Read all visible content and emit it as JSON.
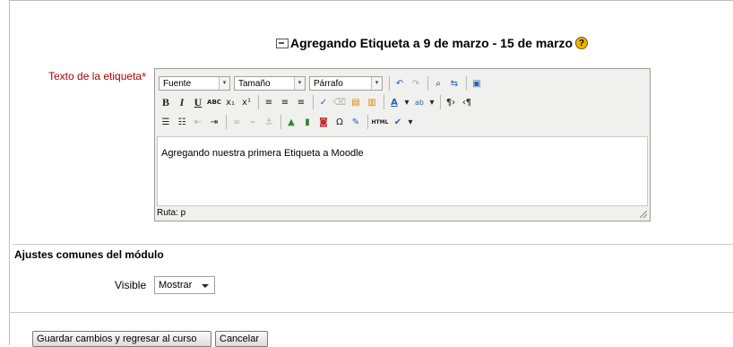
{
  "page": {
    "title": "Agregando Etiqueta a 9 de marzo - 15 de marzo",
    "help_icon": "help-icon",
    "module_icon": "label-module-icon"
  },
  "form": {
    "label_field": {
      "label": "Texto de la etiqueta",
      "required_mark": "*"
    }
  },
  "editor": {
    "font_select": "Fuente",
    "size_select": "Tamaño",
    "format_select": "Párrafo",
    "content": "Agregando nuestra primera Etiqueta a Moodle",
    "path_label": "Ruta: p",
    "toolbar_icons": {
      "undo": "undo-icon",
      "redo": "redo-icon",
      "find": "find-icon",
      "replace": "replace-icon",
      "fullscreen": "fullscreen-icon",
      "bold": "B",
      "italic": "I",
      "underline": "U",
      "strike": "ABC",
      "subscript": "x₁",
      "superscript": "x¹",
      "html": "HTML"
    }
  },
  "module_settings": {
    "title": "Ajustes comunes del módulo",
    "visible_label": "Visible",
    "visible_value": "Mostrar"
  },
  "buttons": {
    "save": "Guardar cambios y regresar al curso",
    "cancel": "Cancelar"
  }
}
